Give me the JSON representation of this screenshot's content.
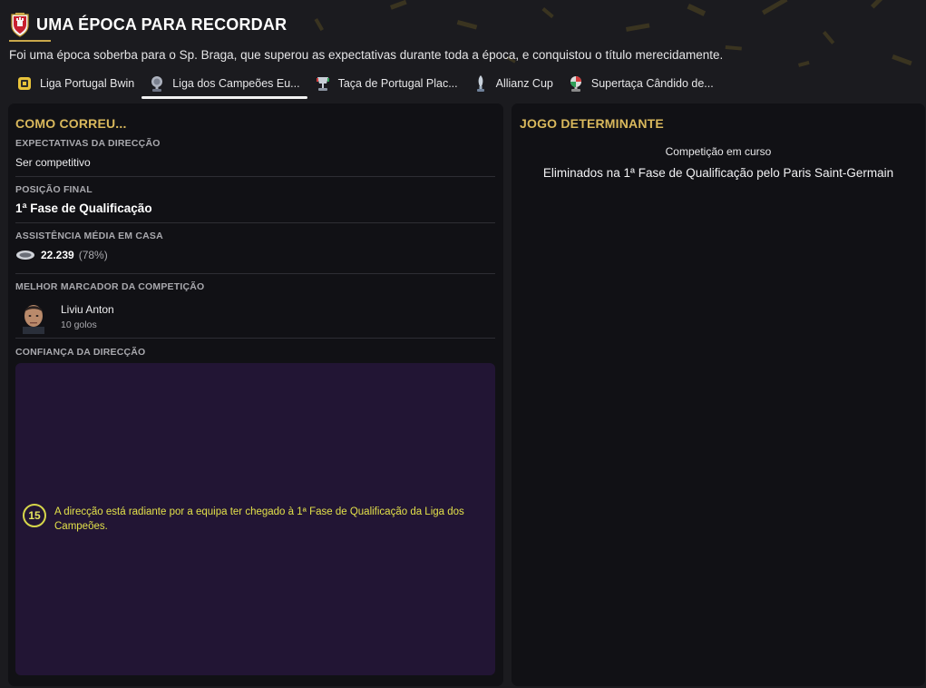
{
  "header": {
    "title": "UMA ÉPOCA PARA RECORDAR",
    "subtitle": "Foi uma época soberba para o Sp. Braga, que superou as expectativas durante toda a época, e conquistou o título merecidamente.",
    "crest_icon": "club-crest-icon"
  },
  "tabs": [
    {
      "label": "Liga Portugal Bwin",
      "icon": "league-trophy-icon",
      "active": false
    },
    {
      "label": "Liga dos Campeões Eu...",
      "icon": "champions-trophy-icon",
      "active": true
    },
    {
      "label": "Taça de Portugal Plac...",
      "icon": "cup-trophy-icon",
      "active": false
    },
    {
      "label": "Allianz Cup",
      "icon": "allianz-trophy-icon",
      "active": false
    },
    {
      "label": "Supertaça Cândido de...",
      "icon": "supercup-trophy-icon",
      "active": false
    }
  ],
  "how_it_went": {
    "heading": "COMO CORREU...",
    "expectations_label": "EXPECTATIVAS DA DIRECÇÃO",
    "expectations_value": "Ser competitivo",
    "final_position_label": "POSIÇÃO FINAL",
    "final_position_value": "1ª Fase de Qualificação",
    "attendance_label": "ASSISTÊNCIA MÉDIA EM CASA",
    "attendance_value": "22.239",
    "attendance_pct": "(78%)",
    "top_scorer_label": "MELHOR MARCADOR DA COMPETIÇÃO",
    "top_scorer_name": "Liviu Anton",
    "top_scorer_goals": "10 golos",
    "confidence_label": "CONFIANÇA DA DIRECÇÃO",
    "confidence_score": "15",
    "confidence_text": "A direcção está radiante por a equipa ter chegado à 1ª Fase de Qualificação da Liga dos Campeões."
  },
  "decisive_game": {
    "heading": "JOGO DETERMINANTE",
    "competition": "Competição em curso",
    "result": "Eliminados na 1ª Fase de Qualificação pelo Paris Saint-Germain"
  },
  "colors": {
    "accent_gold": "#d9b85c",
    "confidence_yellow": "#e2e04a",
    "confidence_bg": "#221534"
  }
}
